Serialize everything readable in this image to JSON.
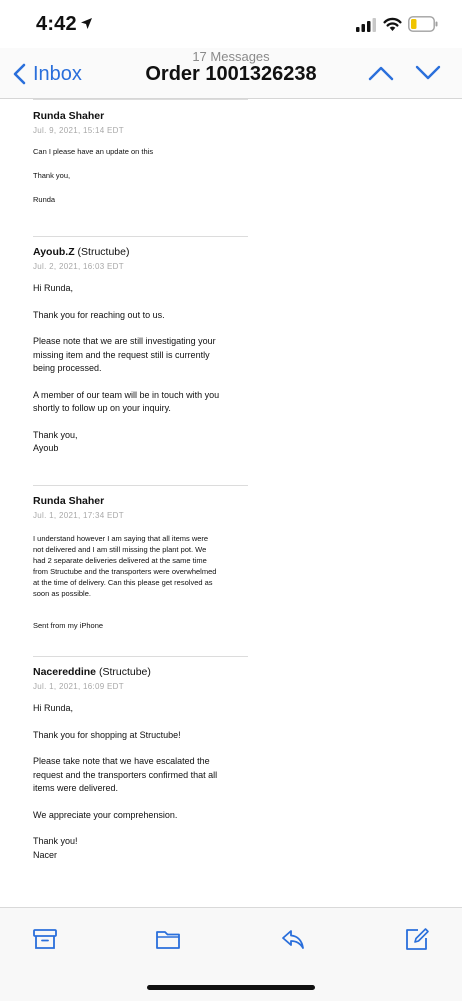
{
  "status": {
    "time": "4:42"
  },
  "nav": {
    "back_label": "Inbox",
    "message_count": "17 Messages",
    "title": "Order 1001326238"
  },
  "messages": [
    {
      "sender": "Runda Shaher",
      "org": "",
      "date": "Jul. 9, 2021, 15:14 EDT",
      "paragraphs": [
        "Can I please have an update on this",
        "Thank you,",
        "Runda"
      ]
    },
    {
      "sender": "Ayoub.Z",
      "org": "(Structube)",
      "date": "Jul. 2, 2021, 16:03 EDT",
      "paragraphs": [
        "Hi Runda,",
        "Thank you for reaching out to us.",
        "Please note that we are still investigating your\nmissing item and the request still is currently\nbeing processed.",
        "A member of our team will be in touch with you\nshortly to follow up on your inquiry.",
        "Thank you,\nAyoub"
      ]
    },
    {
      "sender": "Runda Shaher",
      "org": "",
      "date": "Jul. 1, 2021, 17:34 EDT",
      "paragraphs": [
        "I understand however I am saying that all items were\nnot delivered and I am still missing the plant pot. We\nhad 2 separate deliveries delivered at the same time\nfrom Structube and the transporters were overwhelmed\nat the time of delivery. Can this please get resolved as\nsoon as possible.",
        "Sent from my iPhone"
      ]
    },
    {
      "sender": "Nacereddine",
      "org": "(Structube)",
      "date": "Jul. 1, 2021, 16:09 EDT",
      "paragraphs": [
        "Hi Runda,",
        " Thank you for shopping at Structube!",
        "Please take note that we have escalated the\nrequest and the transporters confirmed that all\nitems were delivered.",
        "We appreciate your comprehension.",
        "Thank you!\nNacer"
      ]
    }
  ],
  "toolbar": {
    "icons": [
      "archive-icon",
      "folder-icon",
      "reply-icon",
      "compose-icon"
    ]
  },
  "colors": {
    "accent": "#2a6fdb"
  }
}
